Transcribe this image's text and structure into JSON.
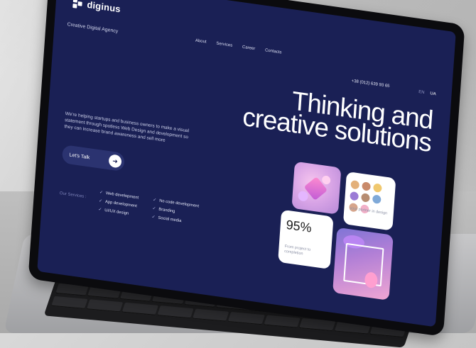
{
  "brand": {
    "name": "diginus",
    "tagline": "Creative Digital Agency"
  },
  "nav": {
    "items": [
      "About",
      "Services",
      "Career",
      "Contacts"
    ]
  },
  "contact": {
    "phone": "+38 (012) 639 93 65"
  },
  "lang": {
    "en": "EN",
    "ua": "UA"
  },
  "hero": {
    "title_line1": "Thinking and",
    "title_line2": "creative solutions",
    "lead": "We're helping startups and business owners to make a visual statement through spotless Web Design and development so they can increase brand awareness and sell more",
    "cta": "Let's Talk"
  },
  "services": {
    "title": "Our Services :",
    "items": [
      "Web development",
      "No code development",
      "App development",
      "Branding",
      "UI/UX design",
      "Social media"
    ]
  },
  "cards": {
    "team_caption": "your partner in design",
    "stat_value": "95%",
    "stat_caption": "From project to completion"
  },
  "colors": {
    "screen_bg": "#1a2055",
    "accent_button": "#2b3370",
    "text_primary": "#ffffff"
  },
  "icons": {
    "logo": "diginus-logo-icon",
    "cta_arrow": "arrow-right-icon",
    "service_check": "check-icon"
  }
}
